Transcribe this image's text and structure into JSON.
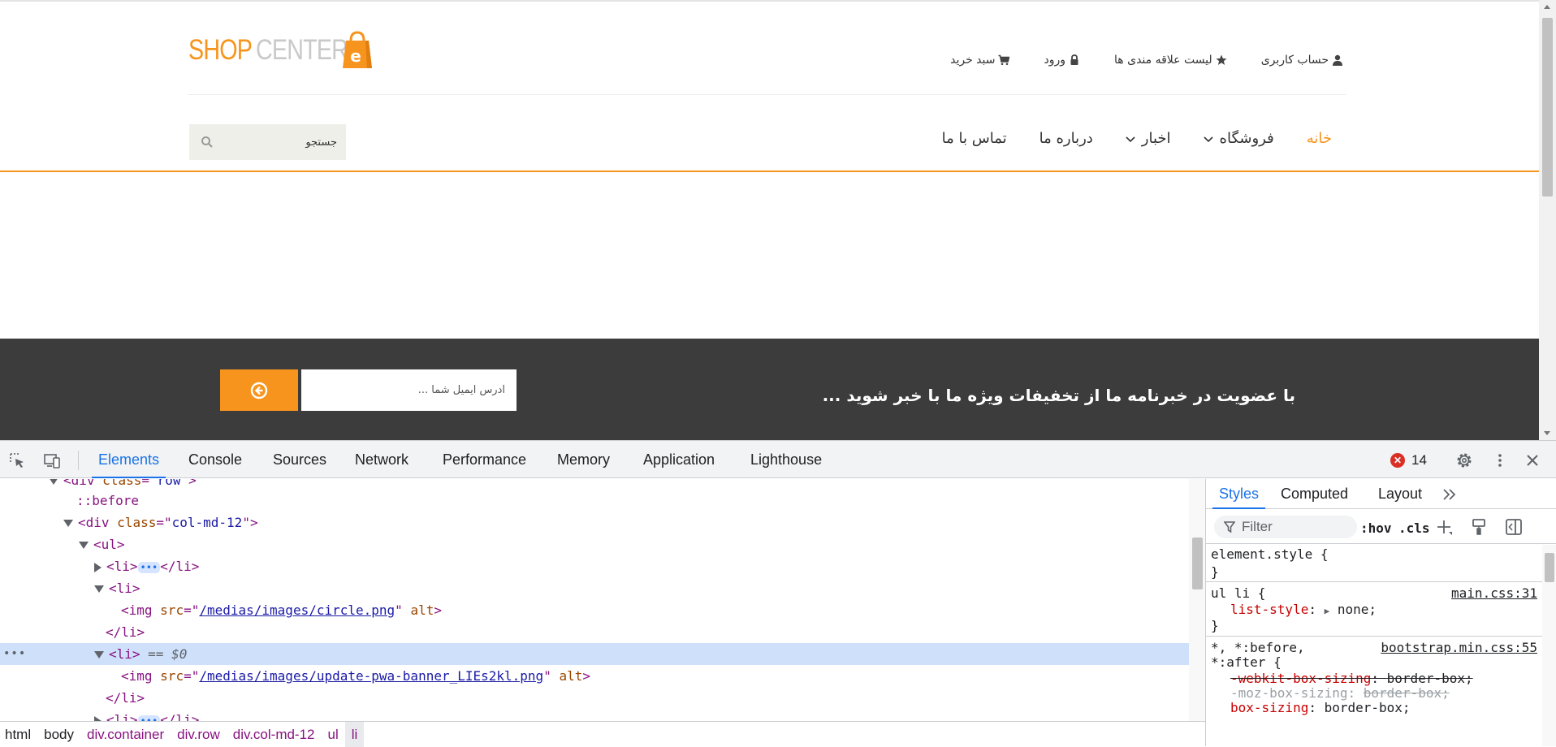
{
  "site": {
    "logo": {
      "part1": "SHOP",
      "part2": "CENTER",
      "badge": "e"
    },
    "top_links": [
      {
        "label": "حساب کاربری",
        "icon": "user-icon"
      },
      {
        "label": "لیست علاقه مندی ها",
        "icon": "star-icon"
      },
      {
        "label": "ورود",
        "icon": "lock-icon"
      },
      {
        "label": "سبد خرید",
        "icon": "cart-icon"
      }
    ],
    "nav": [
      {
        "label": "خانه",
        "active": true,
        "dropdown": false
      },
      {
        "label": "فروشگاه",
        "active": false,
        "dropdown": true
      },
      {
        "label": "اخبار",
        "active": false,
        "dropdown": true
      },
      {
        "label": "درباره ما",
        "active": false,
        "dropdown": false
      },
      {
        "label": "تماس با ما",
        "active": false,
        "dropdown": false
      }
    ],
    "search": {
      "placeholder": "جستجو"
    },
    "newsletter": {
      "text": "با عضویت در خبرنامه ما از تخفیفات ویژه ما با خبر شوید ...",
      "email_placeholder": "آدرس ایمیل شما ..."
    },
    "colors": {
      "accent": "#f7941d",
      "dark_band": "#3c3c3c"
    }
  },
  "devtools": {
    "tabs": [
      "Elements",
      "Console",
      "Sources",
      "Network",
      "Performance",
      "Memory",
      "Application",
      "Lighthouse"
    ],
    "active_tab": "Elements",
    "error_count": "14",
    "dom": {
      "row1_class": "row",
      "before": "::before",
      "col_class": "col-md-12",
      "img1_src": "/medias/images/circle.png",
      "img2_src": "/medias/images/update-pwa-banner_LIEs2kl.png",
      "selected_marker": "== $0"
    },
    "breadcrumb": [
      "html",
      "body",
      "div.container",
      "div.row",
      "div.col-md-12",
      "ul",
      "li"
    ],
    "styles": {
      "tabs": [
        "Styles",
        "Computed",
        "Layout"
      ],
      "filter_placeholder": "Filter",
      "hov": ":hov",
      "cls": ".cls",
      "element_style": "element.style {",
      "rule1_selector": "ul li {",
      "rule1_source": "main.css:31",
      "rule1_prop": "list-style",
      "rule1_val": "none;",
      "rule2_selector1": "*, *:before,",
      "rule2_selector2": "*:after {",
      "rule2_source": "bootstrap.min.css:55",
      "rule2_prop1": "-webkit-box-sizing",
      "rule2_val1": "border-box;",
      "rule2_prop2": "-moz-box-sizing",
      "rule2_val2": "border-box;",
      "rule2_prop3": "box-sizing",
      "rule2_val3": "border-box;",
      "close_brace": "}"
    }
  }
}
